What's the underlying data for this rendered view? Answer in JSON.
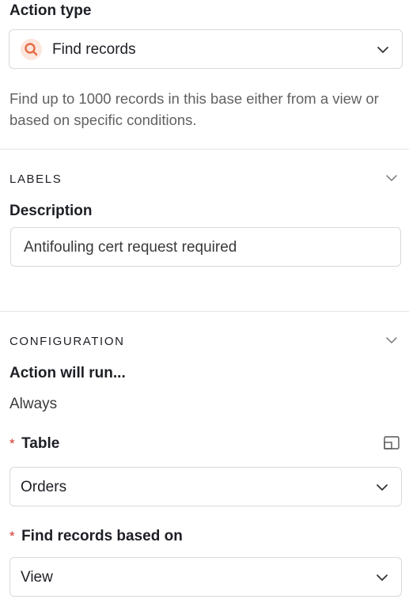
{
  "action_type": {
    "heading": "Action type",
    "selected": "Find records",
    "icon": "search-icon",
    "icon_color": "#e26d48",
    "icon_bg": "#fde6dd",
    "help_text": "Find up to 1000 records in this base either from a view or based on specific conditions."
  },
  "labels": {
    "section_title": "LABELS",
    "description_label": "Description",
    "description_value": "Antifouling cert request required"
  },
  "configuration": {
    "section_title": "CONFIGURATION",
    "run_label": "Action will run...",
    "run_value": "Always",
    "required_marker": "*",
    "table_label": "Table",
    "table_value": "Orders",
    "find_label": "Find records based on",
    "find_value": "View"
  }
}
